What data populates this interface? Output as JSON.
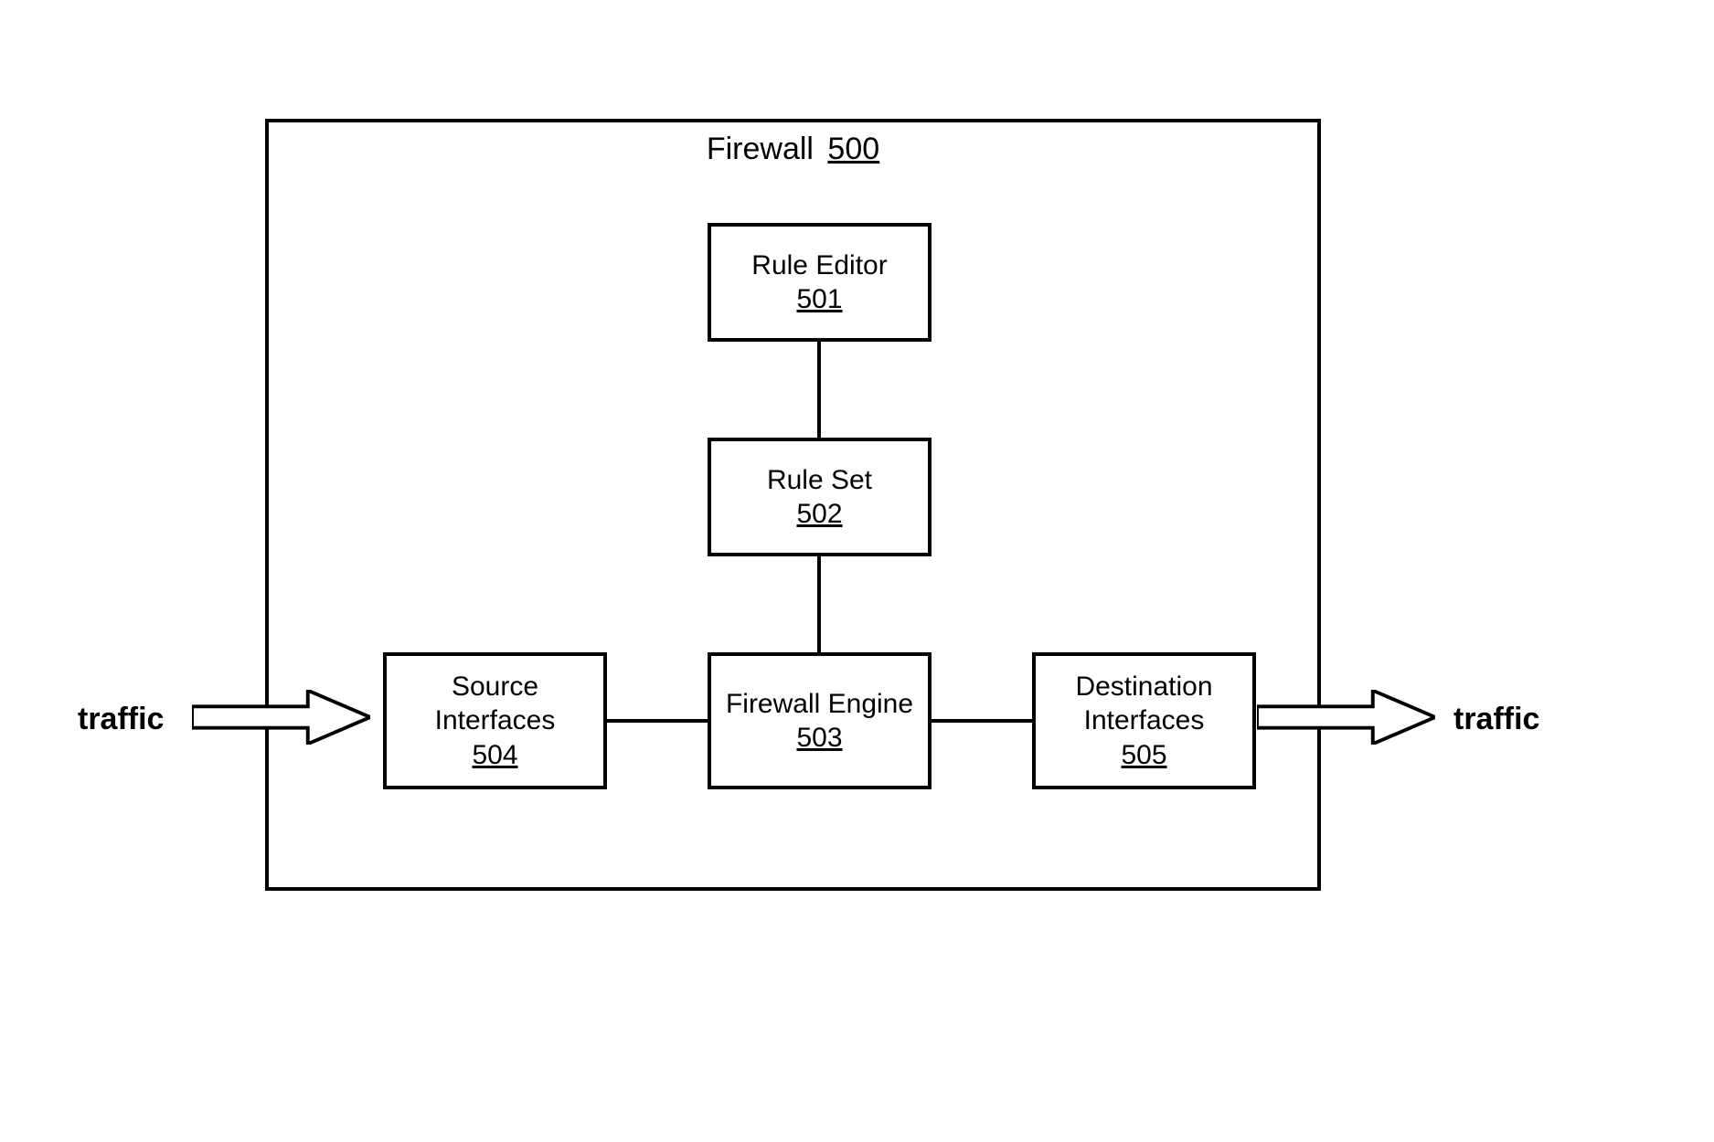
{
  "diagram": {
    "container": {
      "title_name": "Firewall",
      "title_ref": "500"
    },
    "boxes": {
      "rule_editor": {
        "label": "Rule Editor",
        "ref": "501"
      },
      "rule_set": {
        "label": "Rule Set",
        "ref": "502"
      },
      "firewall_engine": {
        "label": "Firewall Engine",
        "ref": "503"
      },
      "source_interfaces": {
        "label_line1": "Source",
        "label_line2": "Interfaces",
        "ref": "504"
      },
      "destination_interfaces": {
        "label_line1": "Destination",
        "label_line2": "Interfaces",
        "ref": "505"
      }
    },
    "traffic": {
      "in_label": "traffic",
      "out_label": "traffic"
    }
  }
}
